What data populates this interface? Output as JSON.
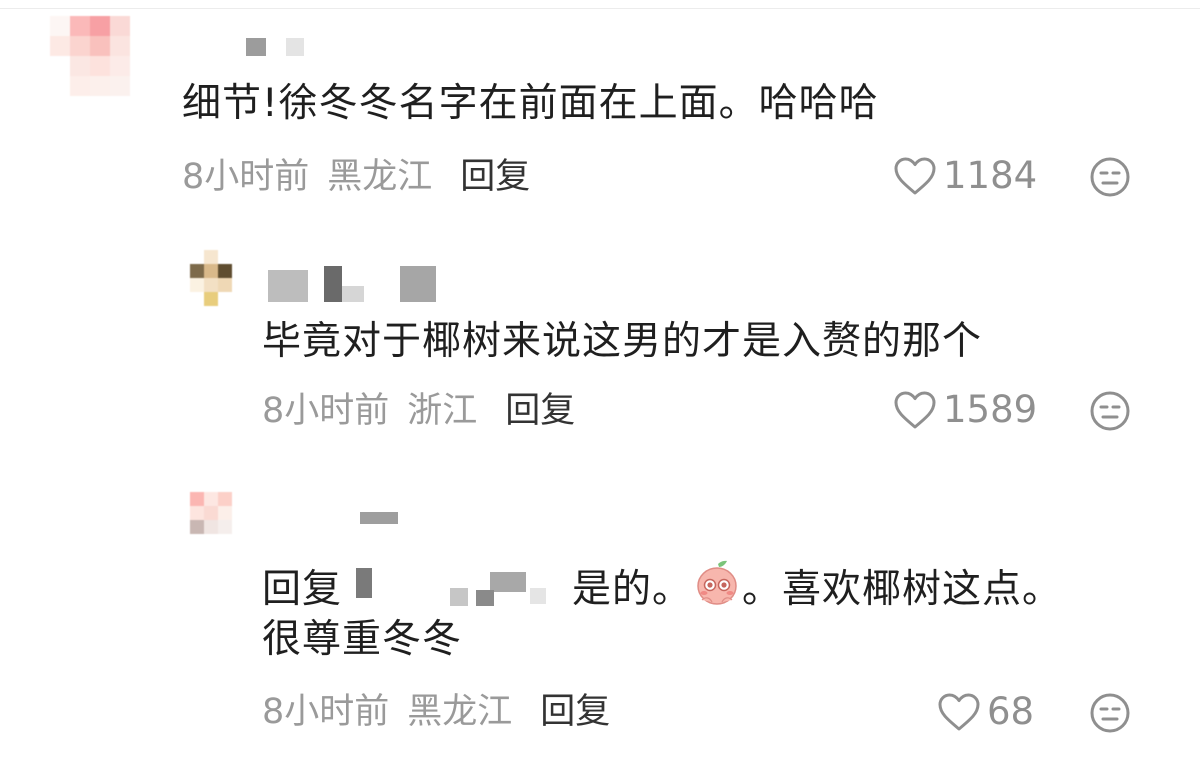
{
  "comments": [
    {
      "text": "细节!徐冬冬名字在前面在上面。哈哈哈",
      "time": "8小时前",
      "location": "黑龙江",
      "reply_label": "回复",
      "likes": "1184",
      "dislike_icon": "dislike-face-icon"
    },
    {
      "text": "毕竟对于椰树来说这男的才是入赘的那个",
      "time": "8小时前",
      "location": "浙江",
      "reply_label": "回复",
      "likes": "1589",
      "dislike_icon": "dislike-face-icon"
    },
    {
      "reply_prefix": "回复",
      "text_after_name": "是的。",
      "text_after_sticker": "。喜欢椰树这点。",
      "text_line2": "很尊重冬冬",
      "sticker_icon": "peach-face-sticker-icon",
      "time": "8小时前",
      "location": "黑龙江",
      "reply_label": "回复",
      "likes": "68",
      "dislike_icon": "dislike-face-icon"
    }
  ],
  "colors": {
    "text": "#1f1f1f",
    "meta": "#9a9a9a",
    "reply": "#333333",
    "icon": "#8f8f8f"
  }
}
